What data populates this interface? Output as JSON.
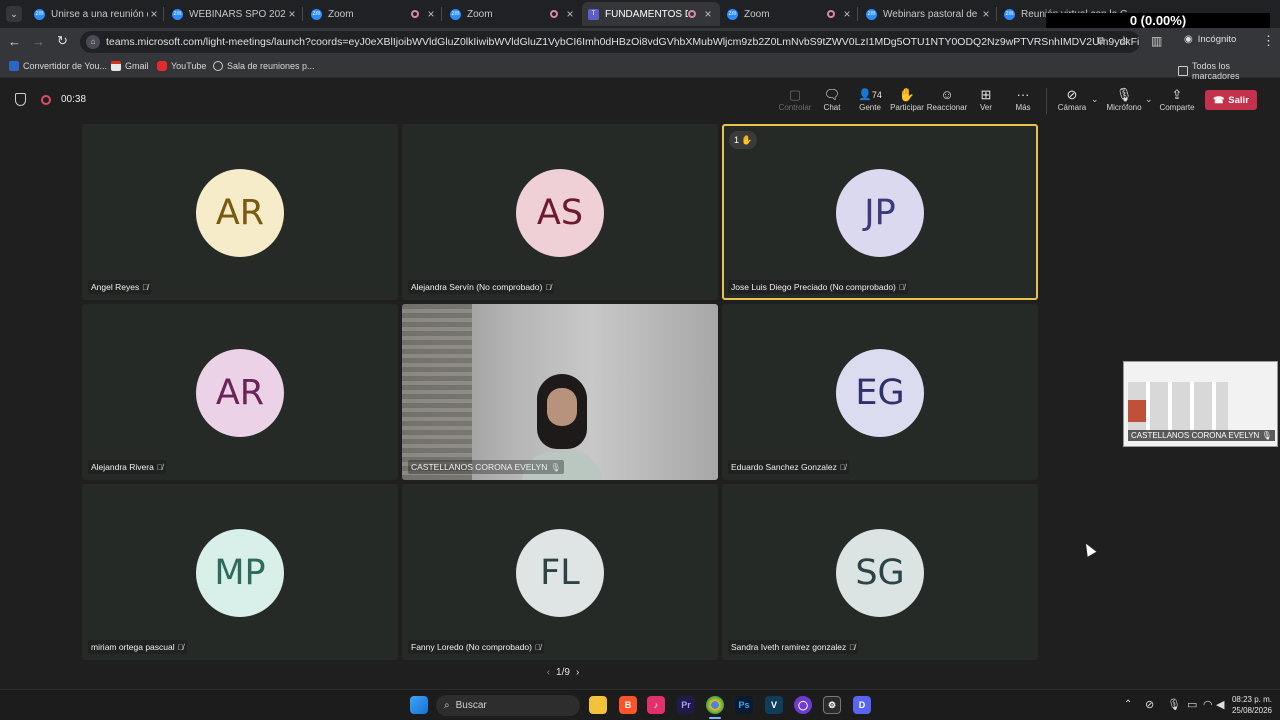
{
  "overlay": {
    "counter": "0 (0.00%)"
  },
  "tabs": [
    {
      "title": "Unirse a una reunión de ",
      "type": "zoom"
    },
    {
      "title": "WEBINARS SPO 2026",
      "type": "zoom"
    },
    {
      "title": "Zoom",
      "type": "zoom"
    },
    {
      "title": "Zoom",
      "type": "rec"
    },
    {
      "title": "FUNDAMENTOS DE M",
      "type": "teams",
      "active": true
    },
    {
      "title": "Zoom",
      "type": "zoom"
    },
    {
      "title": "Webinars pastoral de jóv",
      "type": "zoom"
    },
    {
      "title": "Reunión virtual con la C",
      "type": "zoom"
    }
  ],
  "address": {
    "url": "teams.microsoft.com/light-meetings/launch?coords=eyJ0eXBlIjoibWVldGluZ0lkIiwibWVldGluZ1VybCI6Imh0dHBzOi8vdGVhbXMubWljcm9zb2Z0LmNvbS9tZWV0LzI1MDg5OTU1NTY0ODQ2Nz9wPTVRSnhIMDV2Um9ydkFiSmZxciZhbm9uPX...",
    "incognito_label": "Incógnito"
  },
  "bookmarks": {
    "items": [
      "Convertidor de You...",
      "Gmail",
      "YouTube",
      "Sala de reuniones p..."
    ],
    "all_label": "Todos los marcadores"
  },
  "meeting": {
    "timer": "00:38",
    "participants_count": "74",
    "toolbar": {
      "control": "Controlar",
      "chat": "Chat",
      "people": "Gente",
      "participate": "Participar",
      "react": "Reaccionar",
      "view": "Ver",
      "more": "Más",
      "camera": "Cámara",
      "mic": "Micrófono",
      "share": "Comparte",
      "leave": "Salir"
    },
    "hand_count": "1",
    "pager": "1/9",
    "pip_name": "CASTELLANOS CORONA EVELYN"
  },
  "colors": {
    "leave": "#c4314b",
    "highlight": "#e8c34a"
  },
  "participants": [
    {
      "initials": "AR",
      "name": "Angel Reyes",
      "bg": "#f6ecc9",
      "fg": "#7a5a10"
    },
    {
      "initials": "AS",
      "name": "Alejandra Servín (No comprobado)",
      "bg": "#efd0d6",
      "fg": "#6e1a2d"
    },
    {
      "initials": "JP",
      "name": "Jose Luis Diego Preciado (No comprobado)",
      "bg": "#dad9f0",
      "fg": "#3b3a7a",
      "highlighted": true
    },
    {
      "initials": "AR",
      "name": "Alejandra Rivera",
      "bg": "#ecd2e6",
      "fg": "#6b2459"
    },
    {
      "initials": "",
      "name": "CASTELLANOS CORONA EVELYN",
      "video": true
    },
    {
      "initials": "EG",
      "name": "Eduardo Sanchez Gonzalez",
      "bg": "#dcdcf0",
      "fg": "#30306a"
    },
    {
      "initials": "MP",
      "name": "miriam ortega pascual",
      "bg": "#d9efe9",
      "fg": "#2d6b5c"
    },
    {
      "initials": "FL",
      "name": "Fanny Loredo (No comprobado)",
      "bg": "#dfe5e5",
      "fg": "#2d4346"
    },
    {
      "initials": "SG",
      "name": "Sandra Iveth ramirez gonzalez",
      "bg": "#dbe3e3",
      "fg": "#2c4347"
    }
  ],
  "taskbar": {
    "search": "Buscar",
    "time": "08:23 p. m.",
    "date": "25/08/2026"
  }
}
